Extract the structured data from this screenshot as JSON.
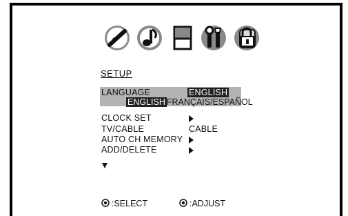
{
  "menu": {
    "title": "SETUP",
    "icons": [
      "picture-icon",
      "sound-icon",
      "setup-icon",
      "tools-icon",
      "lock-icon"
    ],
    "language": {
      "label": "LANGUAGE",
      "value": "ENGLISH",
      "options_selected": "ENGLISH",
      "options_rest": "FRANÇAIS/ESPAÑOL"
    },
    "items": [
      {
        "label": "CLOCK SET",
        "value": ""
      },
      {
        "label": "TV/CABLE",
        "value": "CABLE"
      },
      {
        "label": "AUTO CH MEMORY",
        "value": ""
      },
      {
        "label": "ADD/DELETE",
        "value": ""
      }
    ]
  },
  "footer": {
    "select_label": ":SELECT",
    "adjust_label": ":ADJUST"
  }
}
